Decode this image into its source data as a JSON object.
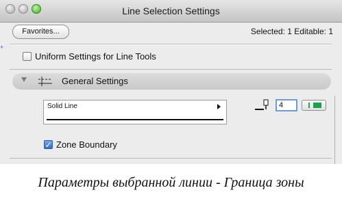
{
  "window": {
    "title": "Line Selection Settings",
    "favorites_label": "Favorites...",
    "selection_info": "Selected: 1 Editable: 1"
  },
  "uniform": {
    "label": "Uniform Settings for Line Tools",
    "checked": false
  },
  "general_section": {
    "title": "General Settings",
    "expanded": true,
    "icon": "line-tool-icon"
  },
  "line_type": {
    "value": "Solid Line"
  },
  "pen": {
    "icon": "pen-icon",
    "number": "4",
    "swatch_color": "#16a34a"
  },
  "zone_boundary": {
    "label": "Zone Boundary",
    "checked": true
  },
  "caption": "Параметры выбранной линии - Граница зоны"
}
